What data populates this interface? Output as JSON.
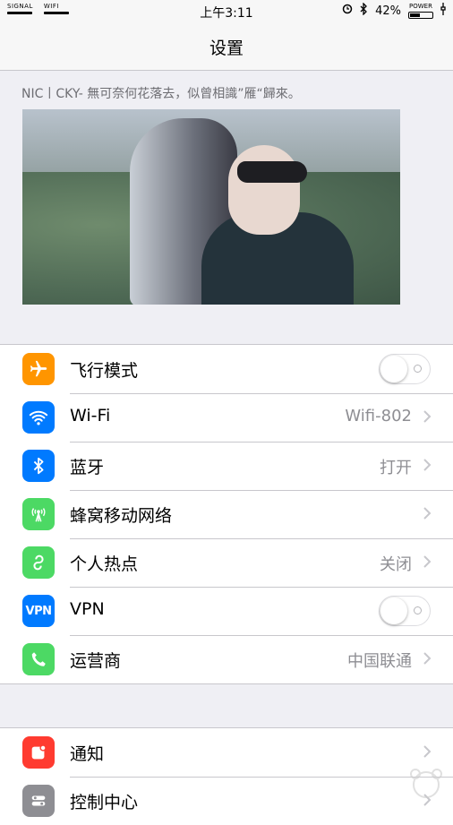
{
  "status": {
    "signal_label": "SIGNAL",
    "wifi_label": "WIFI",
    "time": "上午3:11",
    "battery": "42%",
    "power_label": "POWER"
  },
  "nav": {
    "title": "设置"
  },
  "banner": {
    "text": "NIC丨CKY- 無可奈何花落去，似曾相識”雁“歸來。"
  },
  "section1": [
    {
      "label": "飞行模式",
      "icon": "airplane-icon",
      "color": "#ff9500",
      "toggle": false
    },
    {
      "label": "Wi-Fi",
      "value": "Wifi-802",
      "icon": "wifi-icon",
      "color": "#007aff"
    },
    {
      "label": "蓝牙",
      "value": "打开",
      "icon": "bluetooth-icon",
      "color": "#007aff"
    },
    {
      "label": "蜂窝移动网络",
      "value": "",
      "icon": "cellular-icon",
      "color": "#4cd964"
    },
    {
      "label": "个人热点",
      "value": "关闭",
      "icon": "hotspot-icon",
      "color": "#4cd964"
    },
    {
      "label": "VPN",
      "icon": "vpn-icon",
      "icon_text": "VPN",
      "color": "#007aff",
      "toggle": false
    },
    {
      "label": "运营商",
      "value": "中国联通",
      "icon": "phone-icon",
      "color": "#4cd964"
    }
  ],
  "section2": [
    {
      "label": "通知",
      "icon": "notifications-icon",
      "color": "#ff3b30"
    },
    {
      "label": "控制中心",
      "icon": "control-center-icon",
      "color": "#8e8e93"
    }
  ]
}
